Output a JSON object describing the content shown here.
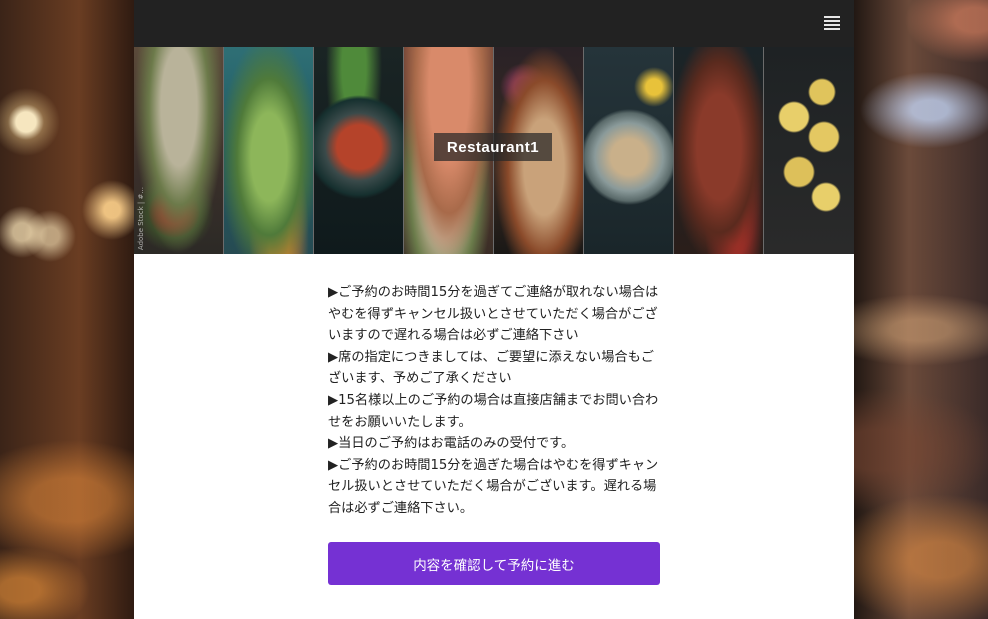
{
  "header": {
    "menu_icon": "hamburger-menu-icon"
  },
  "hero": {
    "title": "Restaurant1",
    "watermark": "Adobe Stock | #..."
  },
  "notes": [
    "▶ご予約のお時間15分を過ぎてご連絡が取れない場合はやむを得ずキャンセル扱いとさせていただく場合がございますので遅れる場合は必ずご連絡下さい",
    "▶席の指定につきましては、ご要望に添えない場合もございます、予めご了承ください",
    "▶15名様以上のご予約の場合は直接店舗までお問い合わせをお願いいたします。",
    "▶当日のご予約はお電話のみの受付です。",
    "▶ご予約のお時間15分を過ぎた場合はやむを得ずキャンセル扱いとさせていただく場合がございます。遅れる場合は必ずご連絡下さい。"
  ],
  "actions": {
    "proceed_label": "内容を確認して予約に進む"
  },
  "colors": {
    "topbar": "#222222",
    "button": "#7531d3"
  }
}
